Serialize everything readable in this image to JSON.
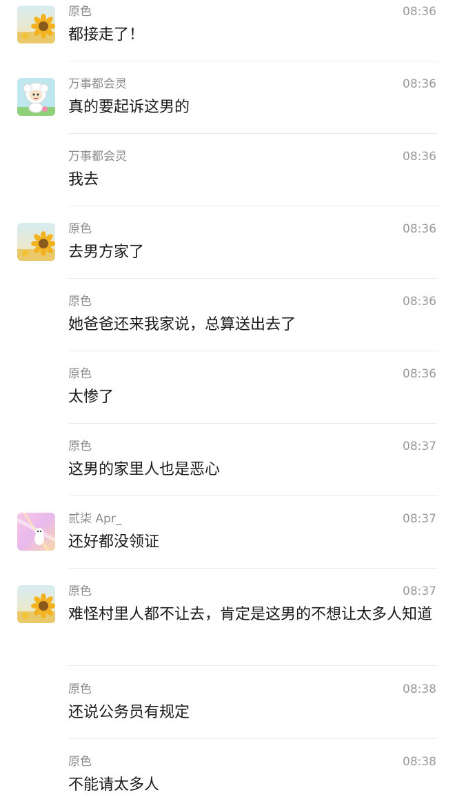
{
  "messages": [
    {
      "sender": "原色",
      "time": "08:36",
      "text": "都接走了！",
      "avatar": "sunflower"
    },
    {
      "sender": "万事都会灵",
      "time": "08:36",
      "text": "真的要起诉这男的",
      "avatar": "sheep"
    },
    {
      "sender": "万事都会灵",
      "time": "08:36",
      "text": "我去",
      "avatar": ""
    },
    {
      "sender": "原色",
      "time": "08:36",
      "text": "去男方家了",
      "avatar": "sunflower"
    },
    {
      "sender": "原色",
      "time": "08:36",
      "text": "她爸爸还来我家说，总算送出去了",
      "avatar": ""
    },
    {
      "sender": "原色",
      "time": "08:36",
      "text": "太惨了",
      "avatar": ""
    },
    {
      "sender": "原色",
      "time": "08:37",
      "text": "这男的家里人也是恶心",
      "avatar": ""
    },
    {
      "sender": "贰柒 Apr_",
      "time": "08:37",
      "text": "还好都没领证",
      "avatar": "pink"
    },
    {
      "sender": "原色",
      "time": "08:37",
      "text": "难怪村里人都不让去，肯定是这男的不想让太多人知道",
      "avatar": "sunflower"
    },
    {
      "sender": "原色",
      "time": "08:38",
      "text": "还说公务员有规定",
      "avatar": ""
    },
    {
      "sender": "原色",
      "time": "08:38",
      "text": "不能请太多人",
      "avatar": ""
    }
  ]
}
